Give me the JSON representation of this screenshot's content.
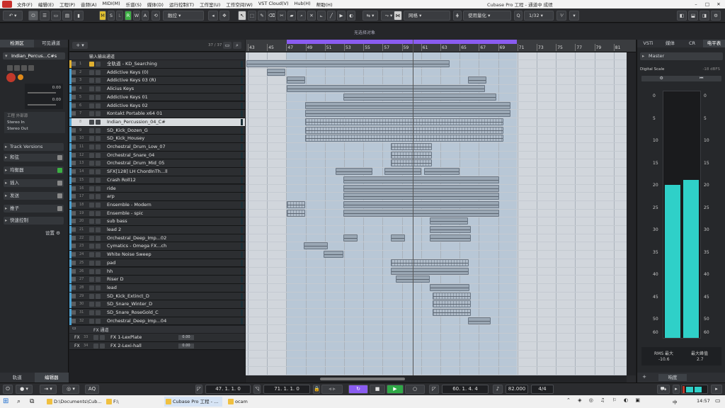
{
  "menubar": {
    "items": [
      "文件(F)",
      "编辑(E)",
      "工程(P)",
      "音频(A)",
      "MIDI(M)",
      "乐谱(S)",
      "媒体(D)",
      "运行控制(T)",
      "工作室(U)",
      "工作空间(W)",
      "VST Cloud(V)",
      "Hub(H)",
      "帮助(H)"
    ],
    "title": "Cubase Pro 工程 - 通道中 成绩"
  },
  "toolbar": {
    "mode_buttons": [
      "M",
      "S",
      "L",
      "R",
      "W",
      "A"
    ],
    "touch_mode": "触控",
    "snap_type": "网格",
    "quantize": "使用量化",
    "quantize_value": "1/32"
  },
  "info_message": "无选择对象",
  "inspector": {
    "tabs": [
      "检测区",
      "可见通道"
    ],
    "track_name": "Indian_Percus...C#s",
    "input": "Stereo In",
    "output": "Stereo Out",
    "io_label": "工程 外部源",
    "sections": [
      "Track Versions",
      "和弦",
      "均衡器",
      "插入",
      "发送",
      "推子",
      "快速控制"
    ],
    "settings_label": "设置",
    "bottom_tabs": [
      "轨道",
      "编辑器"
    ],
    "values": [
      "0.00",
      "0.00"
    ]
  },
  "tracklist": {
    "header_label": "输入输出通道",
    "count": "37 / 37",
    "tracks": [
      {
        "n": "1",
        "name": "全轨道 - KD_Searching",
        "color": "#e0b030"
      },
      {
        "n": "2",
        "name": "Addictive Keys (0)",
        "color": "#4aa0d0"
      },
      {
        "n": "3",
        "name": "Addictive Keys 03 (R)",
        "color": "#4aa0d0"
      },
      {
        "n": "4",
        "name": "Alicius Keys",
        "color": "#4aa0d0"
      },
      {
        "n": "5",
        "name": "Addictive Keys 01",
        "color": "#4aa0d0"
      },
      {
        "n": "6",
        "name": "Addictive Keys 02",
        "color": "#4aa0d0"
      },
      {
        "n": "7",
        "name": "Kontakt Portable x64 01",
        "color": "#4aa0d0"
      },
      {
        "n": "8",
        "name": "Indian_Percussion_04_C#",
        "color": "#4aa0d0"
      },
      {
        "n": "9",
        "name": "SD_Kick_Dozen_G",
        "color": "#4aa0d0"
      },
      {
        "n": "10",
        "name": "SD_Kick_Housey",
        "color": "#4aa0d0"
      },
      {
        "n": "11",
        "name": "Orchestral_Drum_Low_07",
        "color": "#4aa0d0"
      },
      {
        "n": "12",
        "name": "Orchestral_Snare_04",
        "color": "#4aa0d0"
      },
      {
        "n": "13",
        "name": "Orchestral_Drum_Mid_05",
        "color": "#4aa0d0"
      },
      {
        "n": "14",
        "name": "SFX[128] LH ChordInTh...ll",
        "color": "#4aa0d0"
      },
      {
        "n": "15",
        "name": "Crash Roll12",
        "color": "#4aa0d0"
      },
      {
        "n": "16",
        "name": "ride",
        "color": "#4aa0d0"
      },
      {
        "n": "17",
        "name": "arp",
        "color": "#4aa0d0"
      },
      {
        "n": "18",
        "name": "Ensemble - Modern",
        "color": "#4aa0d0"
      },
      {
        "n": "19",
        "name": "Ensemble - spic",
        "color": "#4aa0d0"
      },
      {
        "n": "20",
        "name": "sub bass",
        "color": "#4aa0d0"
      },
      {
        "n": "21",
        "name": "lead 2",
        "color": "#4aa0d0"
      },
      {
        "n": "22",
        "name": "Orchestral_Deep_Imp...02",
        "color": "#4aa0d0"
      },
      {
        "n": "23",
        "name": "Cymatics - Omega FX...ch",
        "color": "#4aa0d0"
      },
      {
        "n": "24",
        "name": "White Noise Sweep",
        "color": "#4aa0d0"
      },
      {
        "n": "25",
        "name": "pad",
        "color": "#4aa0d0"
      },
      {
        "n": "26",
        "name": "hh",
        "color": "#4aa0d0"
      },
      {
        "n": "27",
        "name": "Riser D",
        "color": "#4aa0d0"
      },
      {
        "n": "28",
        "name": "lead",
        "color": "#4aa0d0"
      },
      {
        "n": "29",
        "name": "SD_Kick_Extinct_D",
        "color": "#4aa0d0"
      },
      {
        "n": "30",
        "name": "SD_Snare_Winter_D",
        "color": "#4aa0d0"
      },
      {
        "n": "31",
        "name": "SD_Snare_RoseGold_C",
        "color": "#4aa0d0"
      },
      {
        "n": "32",
        "name": "Orchestral_Deep_Imp...04",
        "color": "#4aa0d0"
      }
    ],
    "fx_folder": "FX 通道",
    "fx_tracks": [
      {
        "n": "33",
        "name": "FX 1-LexPlate",
        "val": "0.00"
      },
      {
        "n": "34",
        "name": "FX 2-Lexi-hall",
        "val": "0.00"
      }
    ]
  },
  "ruler": {
    "bars": [
      "43",
      "45",
      "47",
      "49",
      "51",
      "53",
      "55",
      "57",
      "59",
      "61",
      "63",
      "65",
      "67",
      "69",
      "71",
      "73",
      "75",
      "77",
      "79",
      "81"
    ]
  },
  "mixer": {
    "tabs": [
      "VSTi",
      "媒体",
      "CR",
      "电平表"
    ],
    "channel": "Master",
    "scale_label": "Digital Scale",
    "scale_value": "-18 dBFS",
    "scale_marks": [
      "0",
      "5",
      "10",
      "15",
      "20",
      "25",
      "30",
      "35",
      "40",
      "45",
      "50",
      "60"
    ],
    "rms_label": "RMS 最大",
    "rms_value": "-10.6",
    "peak_label": "最大峰值",
    "peak_value": "2.7",
    "bottom_tab": "响度",
    "levels": [
      0.62,
      0.64
    ]
  },
  "transport": {
    "left_locator": "47. 1. 1.  0",
    "right_locator": "71. 1. 1.  0",
    "position": "60. 1. 4.  4",
    "tempo": "82.000",
    "signature": "4/4"
  },
  "taskbar": {
    "tasks": [
      "D:\\Documents\\Cub...",
      "F:\\",
      "Cubase Pro 工程 - ...",
      "ocam"
    ],
    "lang": "中",
    "time": "14:57"
  }
}
